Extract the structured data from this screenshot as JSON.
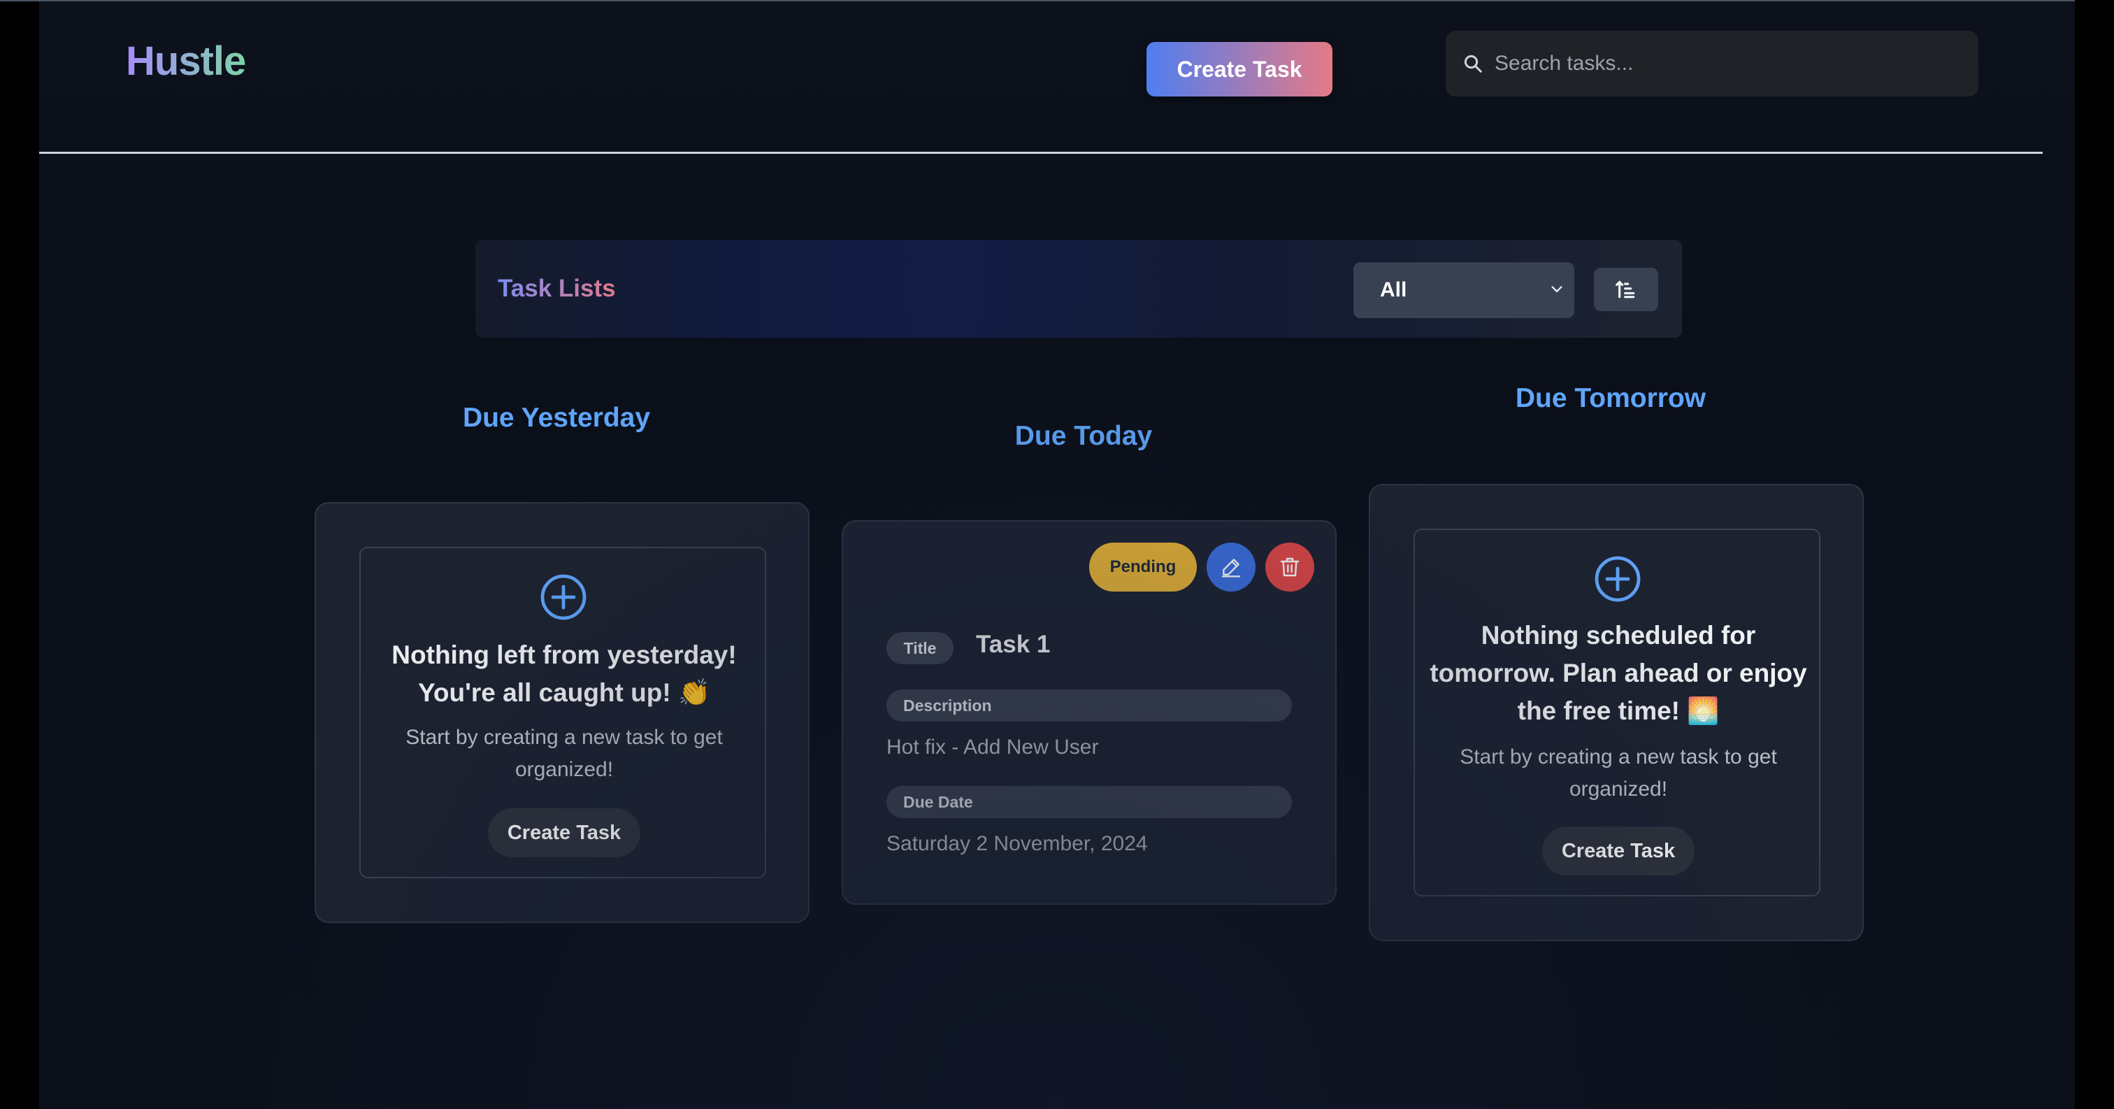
{
  "app": {
    "name": "Hustle"
  },
  "header": {
    "create_task_label": "Create Task",
    "search_placeholder": "Search tasks..."
  },
  "task_lists": {
    "title": "Task Lists",
    "filter_value": "All",
    "sort_icon": "sort-ascending-icon"
  },
  "columns": {
    "yesterday": {
      "title": "Due Yesterday",
      "empty_title": "Nothing left from yesterday! You're all caught up! 👏",
      "empty_sub": "Start by creating a new task to get organized!",
      "create_label": "Create Task"
    },
    "today": {
      "title": "Due Today",
      "task": {
        "status": "Pending",
        "title_label": "Title",
        "title": "Task 1",
        "description_label": "Description",
        "description": "Hot fix - Add New User",
        "due_label": "Due Date",
        "due": "Saturday 2 November, 2024"
      }
    },
    "tomorrow": {
      "title": "Due Tomorrow",
      "empty_title": "Nothing scheduled for tomorrow. Plan ahead or enjoy the free time! 🌅",
      "empty_sub": "Start by creating a new task to get organized!",
      "create_label": "Create Task"
    }
  },
  "colors": {
    "accent_blue": "#60a5fa",
    "pending": "#eab537",
    "edit": "#3b6fe0",
    "delete": "#e04747"
  }
}
